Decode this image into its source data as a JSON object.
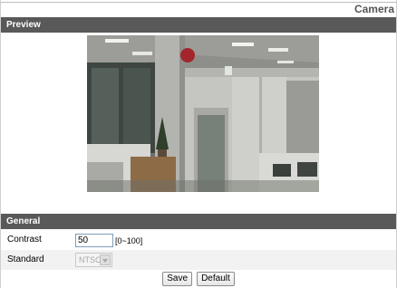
{
  "page": {
    "title": "Camera"
  },
  "preview": {
    "section_title": "Preview",
    "image_icon": "live-camera-feed"
  },
  "general": {
    "section_title": "General",
    "contrast": {
      "label": "Contrast",
      "value": "50",
      "range_hint": "[0~100]"
    },
    "standard": {
      "label": "Standard",
      "selected": "NTSC",
      "disabled": true
    }
  },
  "buttons": {
    "save_label": "Save",
    "default_label": "Default"
  },
  "colors": {
    "section_header_bg": "#595959",
    "section_header_text": "#ffffff",
    "alt_row_bg": "#f2f2f2"
  }
}
